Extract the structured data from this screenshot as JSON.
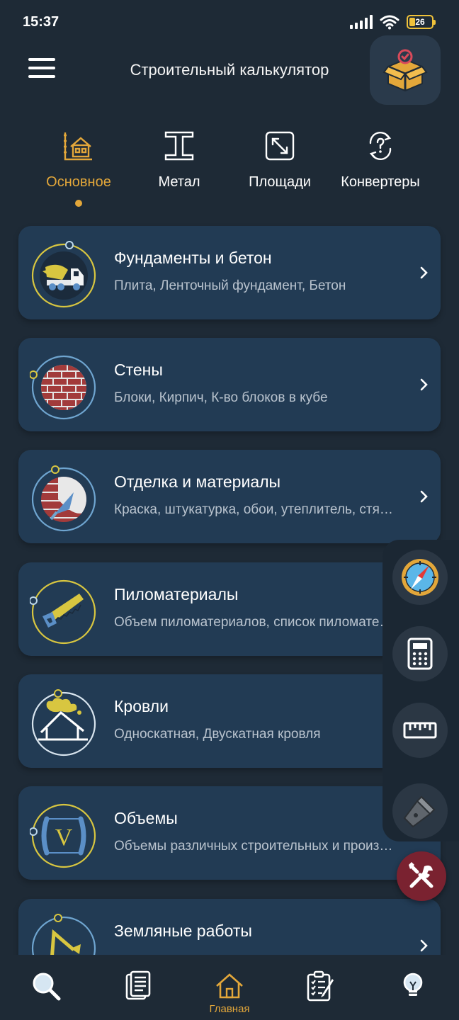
{
  "status": {
    "time": "15:37",
    "battery": "26"
  },
  "header": {
    "title": "Строительный калькулятор",
    "menu_icon": "hamburger-icon",
    "box_icon": "box-check-icon"
  },
  "tabs": [
    {
      "label": "Основное",
      "icon": "house-plan-icon",
      "active": true
    },
    {
      "label": "Метал",
      "icon": "i-beam-icon",
      "active": false
    },
    {
      "label": "Площади",
      "icon": "expand-arrows-icon",
      "active": false
    },
    {
      "label": "Конвертеры",
      "icon": "convert-question-icon",
      "active": false
    }
  ],
  "categories": [
    {
      "title": "Фундаменты и бетон",
      "subtitle": "Плита, Ленточный фундамент, Бетон",
      "icon": "concrete-mixer-icon"
    },
    {
      "title": "Стены",
      "subtitle": "Блоки, Кирпич, К-во блоков в кубе",
      "icon": "brick-wall-icon"
    },
    {
      "title": "Отделка и материалы",
      "subtitle": "Краска, штукатурка, обои, утеплитель, стя…",
      "icon": "trowel-icon"
    },
    {
      "title": "Пиломатериалы",
      "subtitle": "Объем пиломатериалов, список пиломате…",
      "icon": "saw-icon"
    },
    {
      "title": "Кровли",
      "subtitle": "Односкатная, Двускатная кровля",
      "icon": "roof-icon"
    },
    {
      "title": "Объемы",
      "subtitle": "Объемы различных строительных и произ…",
      "icon": "volume-v-icon"
    },
    {
      "title": "Земляные работы",
      "subtitle": "",
      "icon": "excavator-icon"
    }
  ],
  "floating_tools": [
    "compass-icon",
    "calculator-icon",
    "ruler-icon",
    "flashlight-icon",
    "tools-icon"
  ],
  "bottom_nav": [
    {
      "label": "",
      "icon": "search-icon"
    },
    {
      "label": "",
      "icon": "document-icon"
    },
    {
      "label": "Главная",
      "icon": "home-icon"
    },
    {
      "label": "",
      "icon": "checklist-icon"
    },
    {
      "label": "",
      "icon": "lightbulb-icon"
    }
  ],
  "colors": {
    "background": "#1e2a36",
    "card": "#223b54",
    "accent": "#e3a73a",
    "subtitle": "#b9c3ce"
  }
}
